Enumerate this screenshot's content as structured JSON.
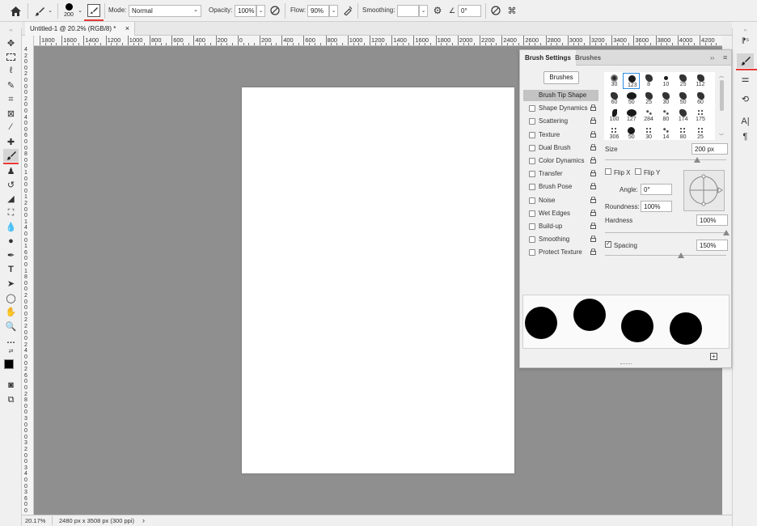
{
  "options_bar": {
    "brush_size": "200",
    "mode_label": "Mode:",
    "mode_value": "Normal",
    "opacity_label": "Opacity:",
    "opacity_value": "100%",
    "flow_label": "Flow:",
    "flow_value": "90%",
    "smoothing_label": "Smoothing:",
    "smoothing_value": "",
    "angle_value": "0°"
  },
  "document": {
    "tab_title": "Untitled-1 @ 20.2% (RGB/8) *",
    "tab_close": "×"
  },
  "ruler_top_labels": [
    "1800",
    "1600",
    "1400",
    "1200",
    "1000",
    "800",
    "600",
    "400",
    "200",
    "0",
    "200",
    "400",
    "600",
    "800",
    "1000",
    "1200",
    "1400",
    "1600",
    "1800",
    "2000",
    "2200",
    "2400",
    "2600",
    "2800",
    "3000",
    "3200",
    "3400",
    "3600",
    "3800",
    "4000",
    "4200"
  ],
  "ruler_left_labels": [
    "4",
    "2",
    "0",
    "0",
    "2",
    "0",
    "0",
    "0",
    "2",
    "0",
    "0",
    "4",
    "0",
    "0",
    "6",
    "0",
    "0",
    "8",
    "0",
    "0",
    "1",
    "0",
    "0",
    "0",
    "1",
    "2",
    "0",
    "0",
    "1",
    "4",
    "0",
    "0",
    "1",
    "6",
    "0",
    "0",
    "1",
    "8",
    "0",
    "0",
    "2",
    "0",
    "0",
    "0",
    "2",
    "2",
    "0",
    "0",
    "2",
    "4",
    "0",
    "0",
    "2",
    "6",
    "0",
    "0",
    "2",
    "8",
    "0",
    "0",
    "3",
    "0",
    "0",
    "0",
    "3",
    "2",
    "0",
    "0",
    "3",
    "4",
    "0",
    "0",
    "3",
    "6",
    "0",
    "0",
    "3",
    "8"
  ],
  "status_bar": {
    "zoom": "20.17%",
    "doc_info": "2480 px x 3508 px (300 ppi)",
    "arrow": "›"
  },
  "panel": {
    "tabs": [
      {
        "label": "Brush Settings"
      },
      {
        "label": "Brushes"
      }
    ],
    "brushes_button": "Brushes",
    "options": [
      {
        "label": "Brush Tip Shape",
        "selected": true
      },
      {
        "label": "Shape Dynamics"
      },
      {
        "label": "Scattering"
      },
      {
        "label": "Texture"
      },
      {
        "label": "Dual Brush"
      },
      {
        "label": "Color Dynamics"
      },
      {
        "label": "Transfer"
      },
      {
        "label": "Brush Pose"
      },
      {
        "label": "Noise"
      },
      {
        "label": "Wet Edges"
      },
      {
        "label": "Build-up"
      },
      {
        "label": "Smoothing"
      },
      {
        "label": "Protect Texture"
      }
    ],
    "lock_glyph": "🔒",
    "brush_thumbs": [
      [
        "30",
        "123",
        "8",
        "10",
        "25",
        "112"
      ],
      [
        "60",
        "50",
        "25",
        "30",
        "50",
        "60"
      ],
      [
        "100",
        "127",
        "284",
        "80",
        "174",
        "175"
      ],
      [
        "306",
        "50",
        "30",
        "14",
        "80",
        "25"
      ]
    ],
    "size_label": "Size",
    "size_value": "200 px",
    "flip_x": "Flip X",
    "flip_y": "Flip Y",
    "angle_label": "Angle:",
    "angle_value": "0°",
    "roundness_label": "Roundness:",
    "roundness_value": "100%",
    "hardness_label": "Hardness",
    "hardness_value": "100%",
    "spacing_label": "Spacing",
    "spacing_value": "150%",
    "spacing_checked": true
  },
  "colors": {
    "accent": "#2a8ae0",
    "active_tool_underline": "#e53935",
    "canvas_bg": "#8f8f8f"
  }
}
